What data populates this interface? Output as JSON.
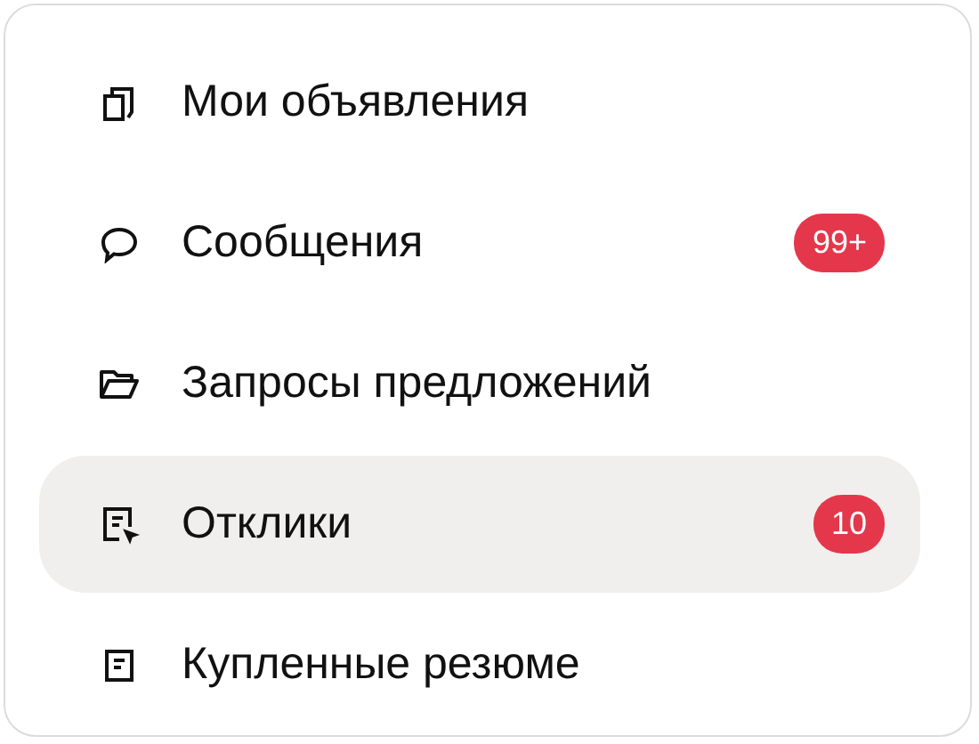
{
  "menu": {
    "items": [
      {
        "kind": "listings",
        "label": "Мои объявления",
        "selected": false
      },
      {
        "kind": "messages",
        "label": "Сообщения",
        "badge": "99+",
        "selected": false
      },
      {
        "kind": "requests",
        "label": "Запросы предложений",
        "selected": false
      },
      {
        "kind": "responses",
        "label": "Отклики",
        "badge": "10",
        "selected": true
      },
      {
        "kind": "resumes",
        "label": "Купленные резюме",
        "selected": false
      }
    ]
  }
}
